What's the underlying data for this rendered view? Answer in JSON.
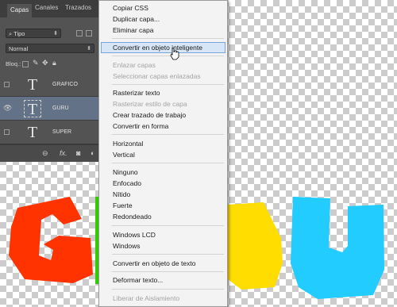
{
  "panel": {
    "tabs": [
      "Capas",
      "Canales",
      "Trazados"
    ],
    "filter_label": "Tipo",
    "blend_mode": "Normal",
    "lock_label": "Bloq.:",
    "layers": [
      {
        "name": "GRAFICO",
        "type_glyph": "T"
      },
      {
        "name": "GURU",
        "type_glyph": "T"
      },
      {
        "name": "SUPER",
        "type_glyph": "T"
      }
    ],
    "footer_fx": "fx."
  },
  "menu": {
    "items": [
      {
        "label": "Copiar CSS",
        "state": "enabled"
      },
      {
        "label": "Duplicar capa...",
        "state": "enabled"
      },
      {
        "label": "Eliminar capa",
        "state": "enabled"
      },
      {
        "label": "Convertir en objeto inteligente",
        "state": "hover"
      },
      {
        "label": "Enlazar capas",
        "state": "disabled"
      },
      {
        "label": "Seleccionar capas enlazadas",
        "state": "disabled"
      },
      {
        "label": "Rasterizar texto",
        "state": "enabled"
      },
      {
        "label": "Rasterizar estilo de capa",
        "state": "disabled"
      },
      {
        "label": "Crear trazado de trabajo",
        "state": "enabled"
      },
      {
        "label": "Convertir en forma",
        "state": "enabled"
      },
      {
        "label": "Horizontal",
        "state": "enabled"
      },
      {
        "label": "Vertical",
        "state": "enabled"
      },
      {
        "label": "Ninguno",
        "state": "enabled"
      },
      {
        "label": "Enfocado",
        "state": "enabled"
      },
      {
        "label": "Nítido",
        "state": "enabled"
      },
      {
        "label": "Fuerte",
        "state": "enabled"
      },
      {
        "label": "Redondeado",
        "state": "enabled"
      },
      {
        "label": "Windows LCD",
        "state": "enabled"
      },
      {
        "label": "Windows",
        "state": "enabled"
      },
      {
        "label": "Convertir en objeto de texto",
        "state": "enabled"
      },
      {
        "label": "Deformar texto...",
        "state": "enabled"
      },
      {
        "label": "Liberar de Aislamiento",
        "state": "disabled"
      }
    ]
  },
  "colors": {
    "letter_red": "#ff3300",
    "letter_green": "#33cc00",
    "letter_yellow": "#ffdd00",
    "letter_cyan": "#22ccff",
    "menu_hover": "#d7e6f6",
    "layer_selected": "#647287"
  }
}
